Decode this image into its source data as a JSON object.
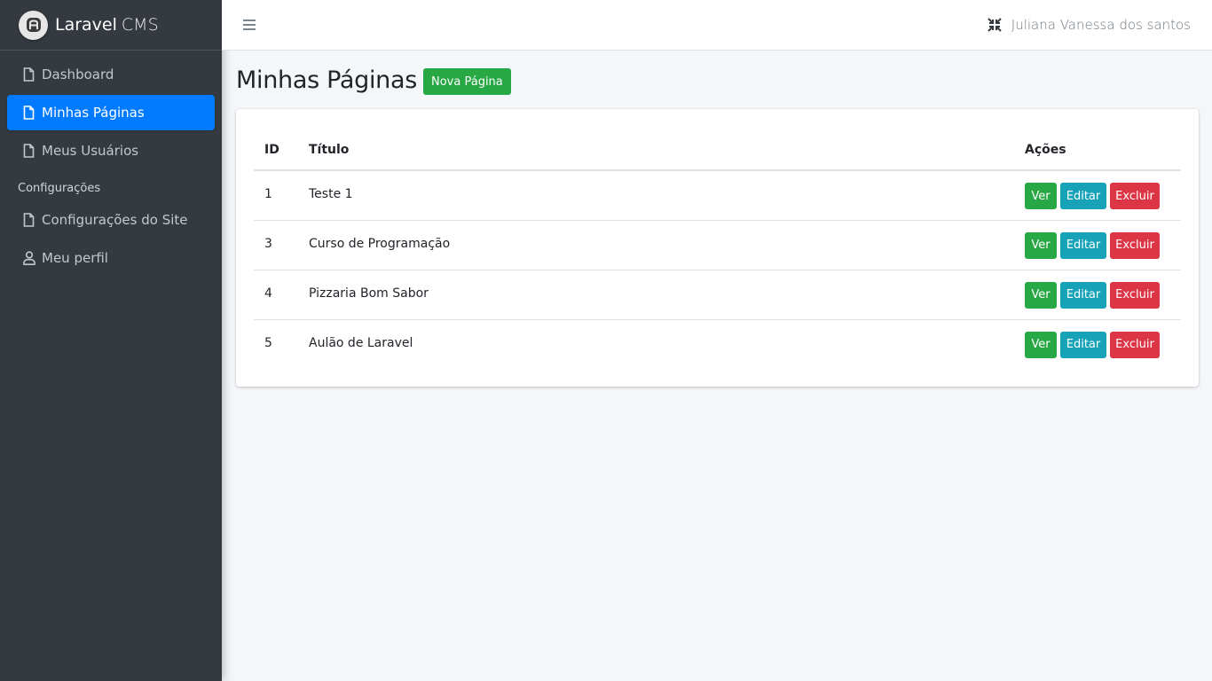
{
  "brand": {
    "name_bold": "Laravel",
    "name_light": "CMS"
  },
  "sidebar": {
    "items": [
      {
        "label": "Dashboard",
        "icon": "file-icon"
      },
      {
        "label": "Minhas Páginas",
        "icon": "file-icon",
        "active": true
      },
      {
        "label": "Meus Usuários",
        "icon": "file-icon"
      }
    ],
    "section_header": "Configurações",
    "settings_items": [
      {
        "label": "Configurações do Site",
        "icon": "file-icon"
      },
      {
        "label": "Meu perfil",
        "icon": "user-icon"
      }
    ]
  },
  "topbar": {
    "user_name": "Juliana Vanessa dos santos",
    "menu_icon": "hamburger-icon",
    "fullscreen_icon": "compress-icon"
  },
  "page": {
    "title": "Minhas Páginas",
    "new_button": "Nova Página"
  },
  "table": {
    "headers": {
      "id": "ID",
      "title": "Título",
      "actions": "Ações"
    },
    "rows": [
      {
        "id": "1",
        "title": "Teste 1"
      },
      {
        "id": "3",
        "title": "Curso de Programação"
      },
      {
        "id": "4",
        "title": "Pizzaria Bom Sabor"
      },
      {
        "id": "5",
        "title": "Aulão de Laravel"
      }
    ],
    "action_labels": {
      "view": "Ver",
      "edit": "Editar",
      "delete": "Excluir"
    }
  },
  "colors": {
    "sidebar_bg": "#343a40",
    "active": "#007bff",
    "success": "#28a745",
    "info": "#17a2b8",
    "danger": "#dc3545"
  }
}
